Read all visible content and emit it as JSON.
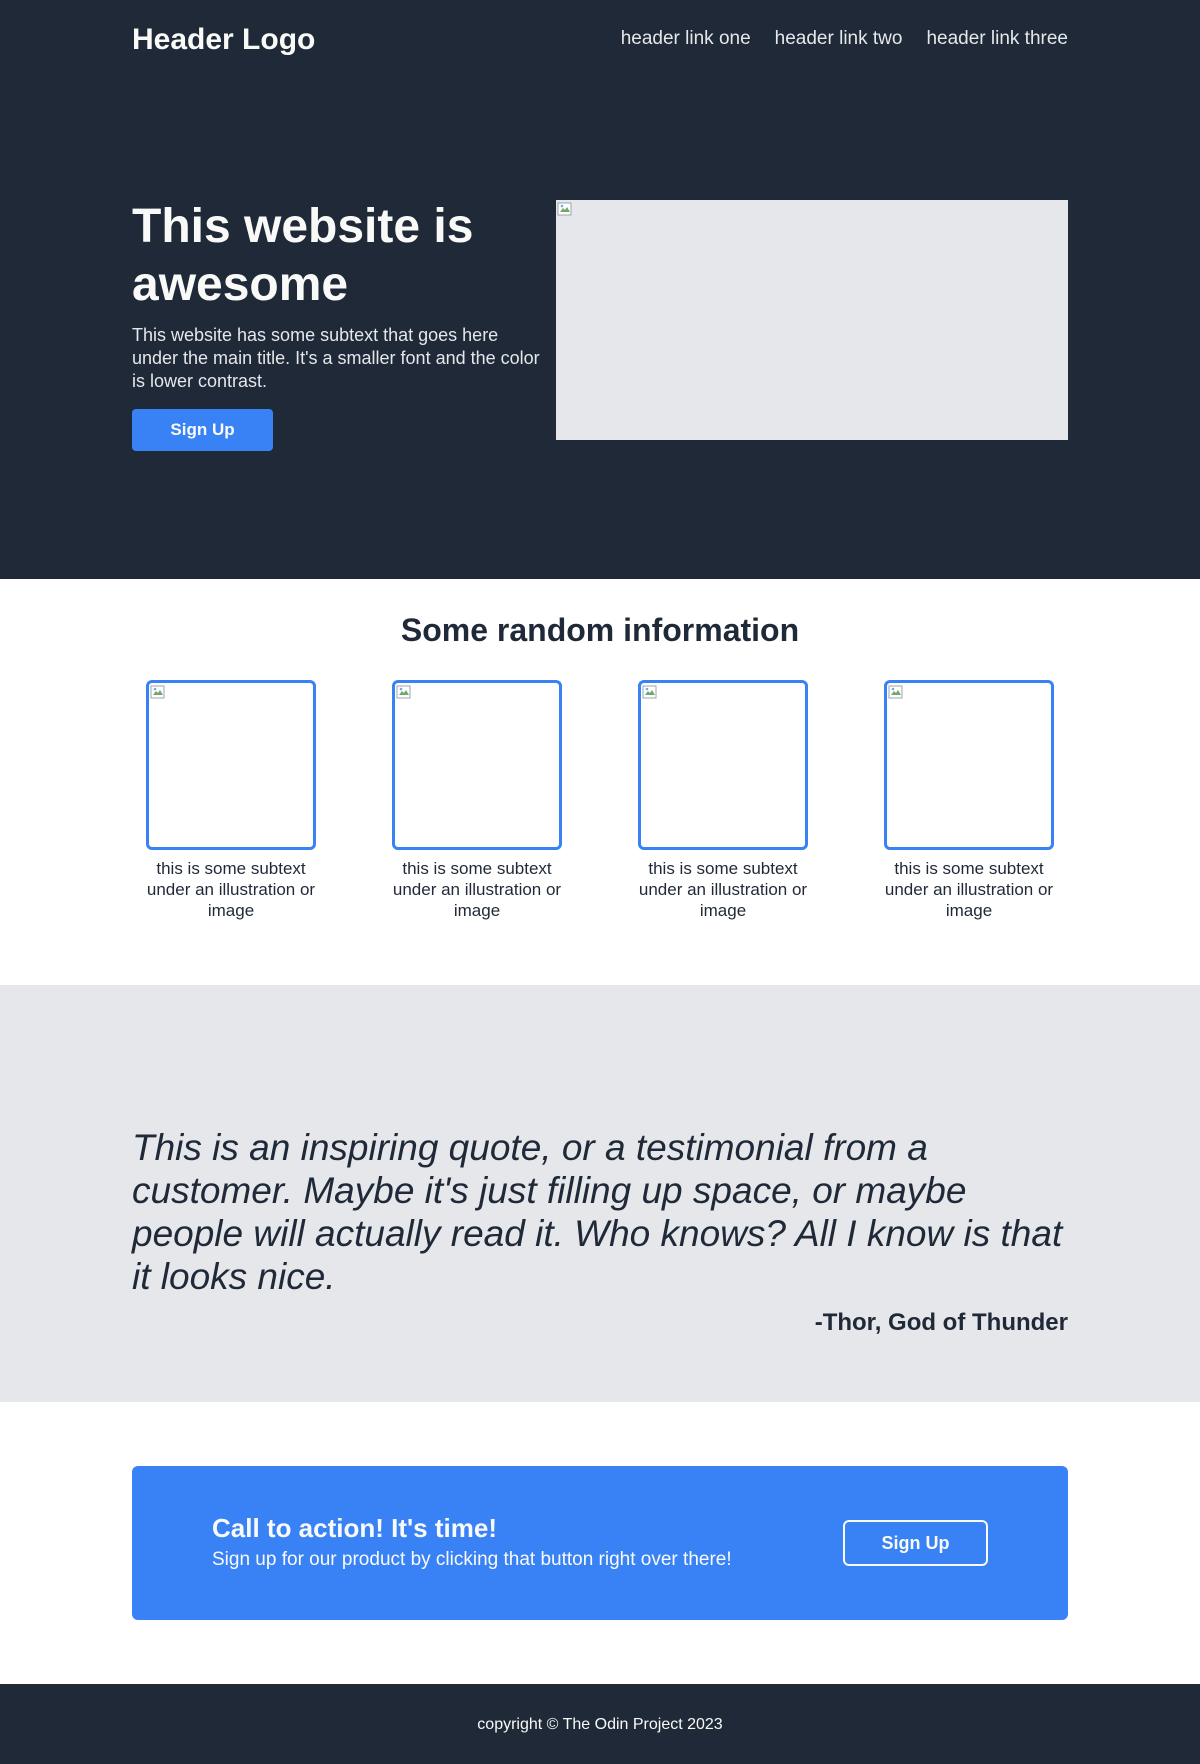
{
  "header": {
    "logo": "Header Logo",
    "links": [
      "header link one",
      "header link two",
      "header link three"
    ]
  },
  "hero": {
    "title": "This website is awesome",
    "subtext": "This website has some subtext that goes here under the main title. It's a smaller font and the color is lower contrast.",
    "button_label": "Sign Up"
  },
  "info": {
    "title": "Some random information",
    "cards": [
      {
        "text": "this is some subtext under an illustration or image"
      },
      {
        "text": "this is some subtext under an illustration or image"
      },
      {
        "text": "this is some subtext under an illustration or image"
      },
      {
        "text": "this is some subtext under an illustration or image"
      }
    ]
  },
  "quote": {
    "text": "This is an inspiring quote, or a testimonial from a customer. Maybe it's just filling up space, or maybe people will actually read it. Who knows? All I know is that it looks nice.",
    "author": "-Thor, God of Thunder"
  },
  "cta": {
    "title": "Call to action! It's time!",
    "subtext": "Sign up for our product by clicking that button right over there!",
    "button_label": "Sign Up"
  },
  "footer": {
    "text": "copyright © The Odin Project 2023"
  },
  "colors": {
    "dark": "#1f2937",
    "accent": "#3882f6",
    "light_gray": "#e5e7eb",
    "off_white": "#f9faf8"
  },
  "icons": {
    "broken_image": "broken-image-icon"
  }
}
